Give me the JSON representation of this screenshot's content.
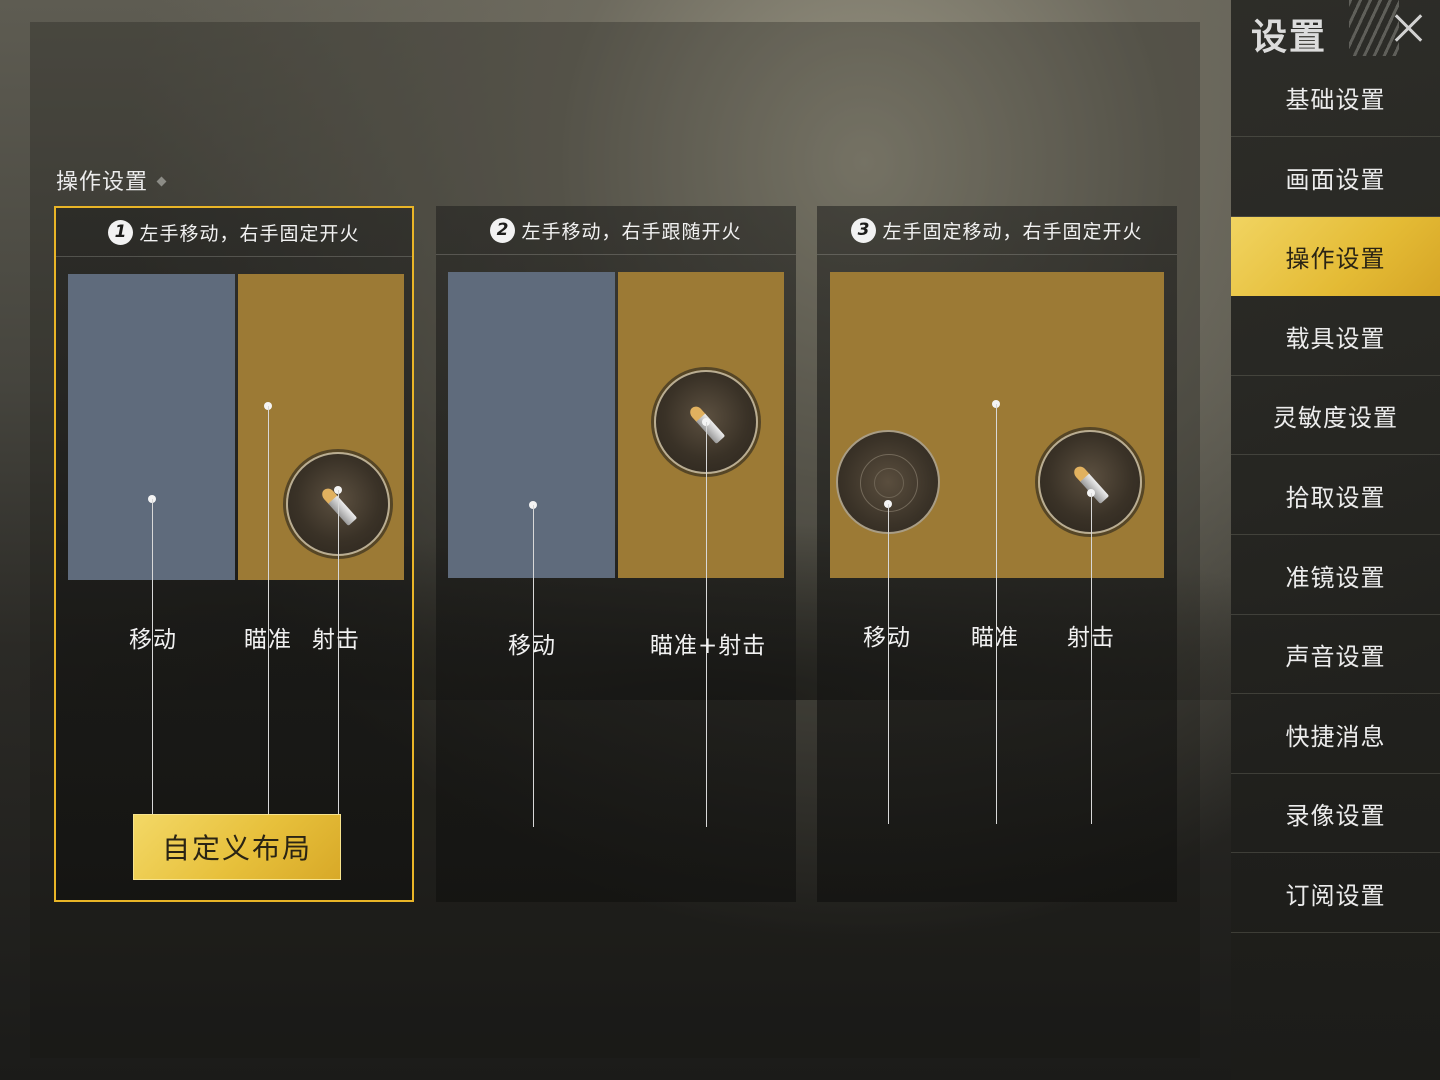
{
  "section_title": "操作设置",
  "cards": [
    {
      "number": "1",
      "title": "左手移动，右手固定开火",
      "selected": true,
      "labels": {
        "move": "移动",
        "aim": "瞄准",
        "fire": "射击"
      },
      "custom_button": "自定义布局"
    },
    {
      "number": "2",
      "title": "左手移动，右手跟随开火",
      "selected": false,
      "labels": {
        "move": "移动",
        "aim_fire": "瞄准+射击"
      }
    },
    {
      "number": "3",
      "title": "左手固定移动，右手固定开火",
      "selected": false,
      "labels": {
        "move": "移动",
        "aim": "瞄准",
        "fire": "射击"
      }
    }
  ],
  "sidebar": {
    "title": "设置",
    "close_icon": "close-icon",
    "items": [
      {
        "label": "基础设置",
        "active": false
      },
      {
        "label": "画面设置",
        "active": false
      },
      {
        "label": "操作设置",
        "active": true
      },
      {
        "label": "载具设置",
        "active": false
      },
      {
        "label": "灵敏度设置",
        "active": false
      },
      {
        "label": "拾取设置",
        "active": false
      },
      {
        "label": "准镜设置",
        "active": false
      },
      {
        "label": "声音设置",
        "active": false
      },
      {
        "label": "快捷消息",
        "active": false
      },
      {
        "label": "录像设置",
        "active": false
      },
      {
        "label": "订阅设置",
        "active": false
      }
    ]
  },
  "colors": {
    "accent_gold": "#e9b527",
    "zone_blue": "#5f6b7c",
    "zone_gold": "#9c7a35"
  }
}
